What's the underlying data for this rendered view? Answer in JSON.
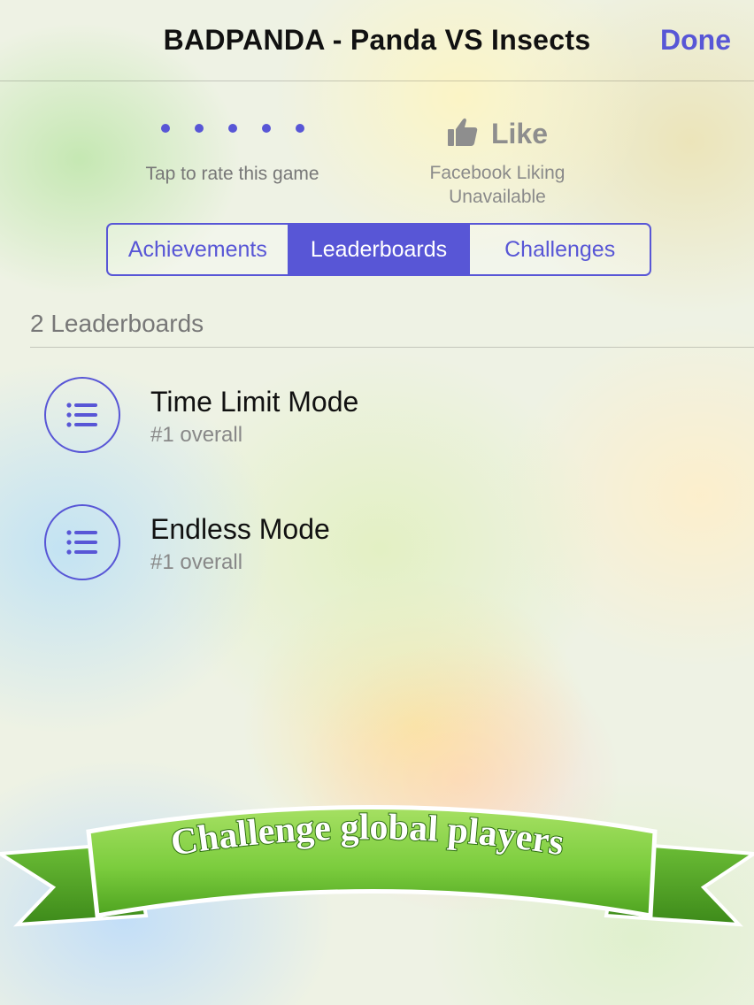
{
  "navbar": {
    "title": "BADPANDA - Panda VS Insects",
    "done_label": "Done"
  },
  "rating": {
    "label": "Tap to rate this game",
    "dot_count": 5
  },
  "like": {
    "label": "Like",
    "status_line1": "Facebook Liking",
    "status_line2": "Unavailable"
  },
  "tabs": [
    {
      "label": "Achievements",
      "active": false
    },
    {
      "label": "Leaderboards",
      "active": true
    },
    {
      "label": "Challenges",
      "active": false
    }
  ],
  "section": {
    "header": "2 Leaderboards"
  },
  "leaderboards": [
    {
      "title": "Time Limit Mode",
      "rank": "#1 overall"
    },
    {
      "title": "Endless Mode",
      "rank": "#1 overall"
    }
  ],
  "banner": {
    "text": "Challenge global players"
  },
  "colors": {
    "accent": "#5856d6",
    "banner_green": "#7ccd3e"
  }
}
